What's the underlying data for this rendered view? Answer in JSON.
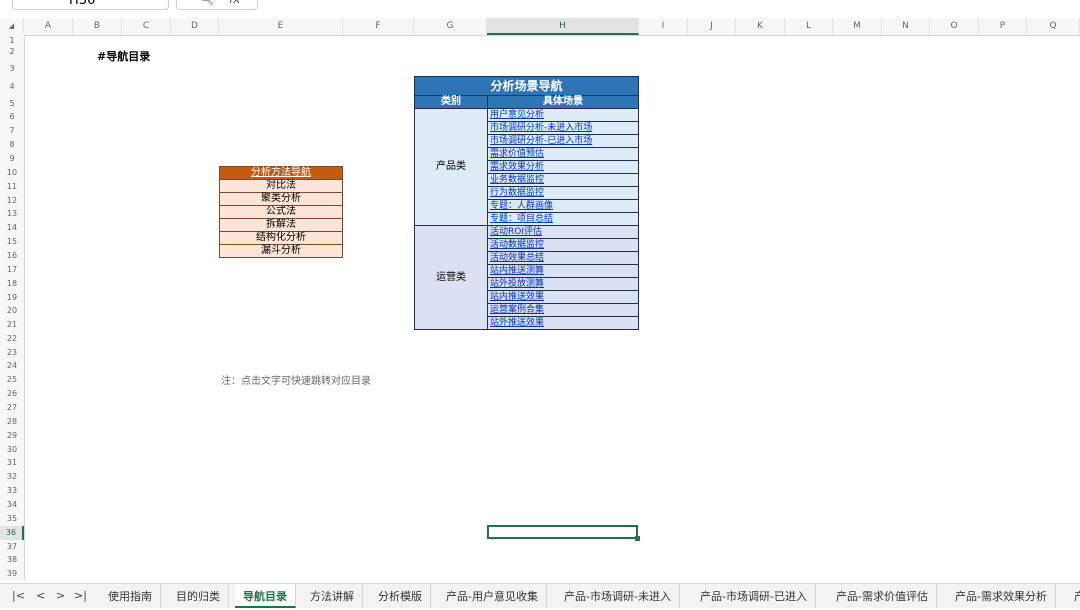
{
  "formula_bar": {
    "cell_ref": "H36",
    "dropdown_icon": "chevron-down-icon",
    "zoom_icon": "magnifier-icon",
    "fx_label": "fx"
  },
  "columns": [
    "A",
    "B",
    "C",
    "D",
    "E",
    "F",
    "G",
    "H",
    "I",
    "J",
    "K",
    "L",
    "M",
    "N",
    "O",
    "P",
    "Q"
  ],
  "corner_glyph": "◢",
  "selected_column": "H",
  "rows": [
    "1",
    "2",
    "3",
    "4",
    "5",
    "6",
    "7",
    "8",
    "9",
    "10",
    "11",
    "12",
    "13",
    "14",
    "15",
    "16",
    "17",
    "18",
    "19",
    "20",
    "21",
    "22",
    "23",
    "24",
    "25",
    "26",
    "27",
    "28",
    "29",
    "30",
    "31",
    "32",
    "33",
    "34",
    "35",
    "36",
    "37",
    "38",
    "39"
  ],
  "selected_row": "36",
  "sheet": {
    "heading": "#导航目录",
    "note": "注：点击文字可快速跳转对应目录"
  },
  "methods_table": {
    "title": "分析方法导航",
    "items": [
      "对比法",
      "聚类分析",
      "公式法",
      "拆解法",
      "结构化分析",
      "漏斗分析"
    ]
  },
  "scenario_table": {
    "title": "分析场景导航",
    "col_category": "类别",
    "col_scene": "具体场景",
    "groups": [
      {
        "category": "产品类",
        "items": [
          "用户意见分析",
          "市场调研分析-未进入市场",
          "市场调研分析-已进入市场",
          "需求价值预估",
          "需求效果分析",
          "业务数据监控",
          "行为数据监控",
          "专题：人群画像",
          "专题：项目总结"
        ]
      },
      {
        "category": "运营类",
        "items": [
          "活动ROI评估",
          "活动数据监控",
          "活动效果总结",
          "站内推送测算",
          "站外投放测算",
          "站内推送效果",
          "运营案例合集",
          "站外推送效果"
        ]
      }
    ]
  },
  "sheet_tabs": {
    "nav": [
      "|<",
      "<",
      ">",
      ">|"
    ],
    "tabs": [
      "使用指南",
      "目的归类",
      "导航目录",
      "方法讲解",
      "分析模版",
      "产品-用户意见收集",
      "产品-市场调研-未进入",
      "产品-市场调研-已进入",
      "产品-需求价值评估",
      "产品-需求效果分析",
      "产"
    ],
    "active": "导航目录"
  },
  "colors": {
    "accent_green": "#217346",
    "methods_header": "#c55a11",
    "methods_fill": "#fce4d6",
    "scenario_header": "#2e75b6",
    "product_fill": "#ddebf7",
    "ops_fill": "#dbe0f2",
    "link": "#0033cc"
  }
}
